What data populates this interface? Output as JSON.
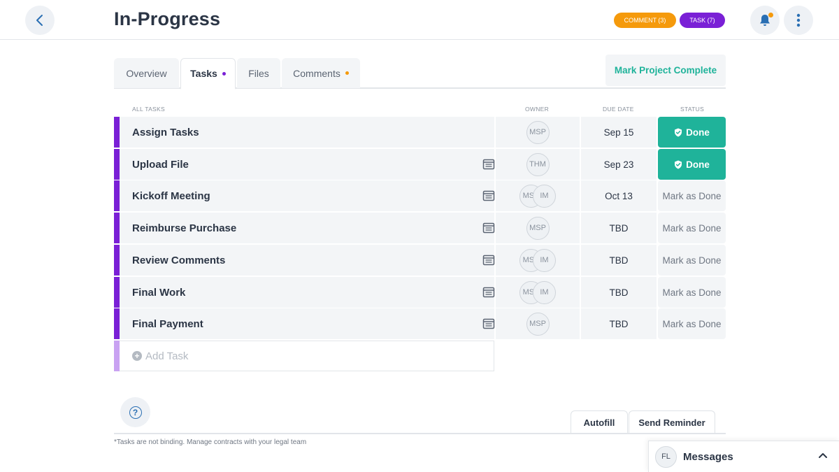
{
  "header": {
    "title": "In-Progress",
    "comment_pill": "COMMENT (3)",
    "task_pill": "TASK (7)"
  },
  "tabs": [
    {
      "label": "Overview",
      "dot": null
    },
    {
      "label": "Tasks",
      "dot": "#7a20d6"
    },
    {
      "label": "Files",
      "dot": null
    },
    {
      "label": "Comments",
      "dot": "#f59a0c"
    }
  ],
  "mark_complete_label": "Mark Project Complete",
  "columns": {
    "all_tasks": "ALL TASKS",
    "owner": "OWNER",
    "due_date": "DUE DATE",
    "status": "STATUS"
  },
  "tasks": [
    {
      "name": "Assign Tasks",
      "has_doc": false,
      "owners": [
        "MSP"
      ],
      "due": "Sep 15",
      "status": "Done",
      "done": true
    },
    {
      "name": "Upload File",
      "has_doc": true,
      "owners": [
        "THM"
      ],
      "due": "Sep 23",
      "status": "Done",
      "done": true
    },
    {
      "name": "Kickoff Meeting",
      "has_doc": true,
      "owners": [
        "MSP",
        "IM"
      ],
      "due": "Oct 13",
      "status": "Mark as Done",
      "done": false
    },
    {
      "name": "Reimburse Purchase",
      "has_doc": true,
      "owners": [
        "MSP"
      ],
      "due": "TBD",
      "status": "Mark as Done",
      "done": false
    },
    {
      "name": "Review Comments",
      "has_doc": true,
      "owners": [
        "MSP",
        "IM"
      ],
      "due": "TBD",
      "status": "Mark as Done",
      "done": false
    },
    {
      "name": "Final Work",
      "has_doc": true,
      "owners": [
        "MSP",
        "IM"
      ],
      "due": "TBD",
      "status": "Mark as Done",
      "done": false
    },
    {
      "name": "Final Payment",
      "has_doc": true,
      "owners": [
        "MSP"
      ],
      "due": "TBD",
      "status": "Mark as Done",
      "done": false
    }
  ],
  "add_task_label": "Add Task",
  "footer": {
    "autofill_label": "Autofill",
    "send_reminder_label": "Send Reminder",
    "disclaimer": "*Tasks are not binding. Manage contracts with your legal team"
  },
  "messages": {
    "avatar": "FL",
    "title": "Messages"
  },
  "colors": {
    "accent_purple": "#7a20d6",
    "accent_orange": "#f59a0c",
    "done_green": "#1fb39a"
  }
}
